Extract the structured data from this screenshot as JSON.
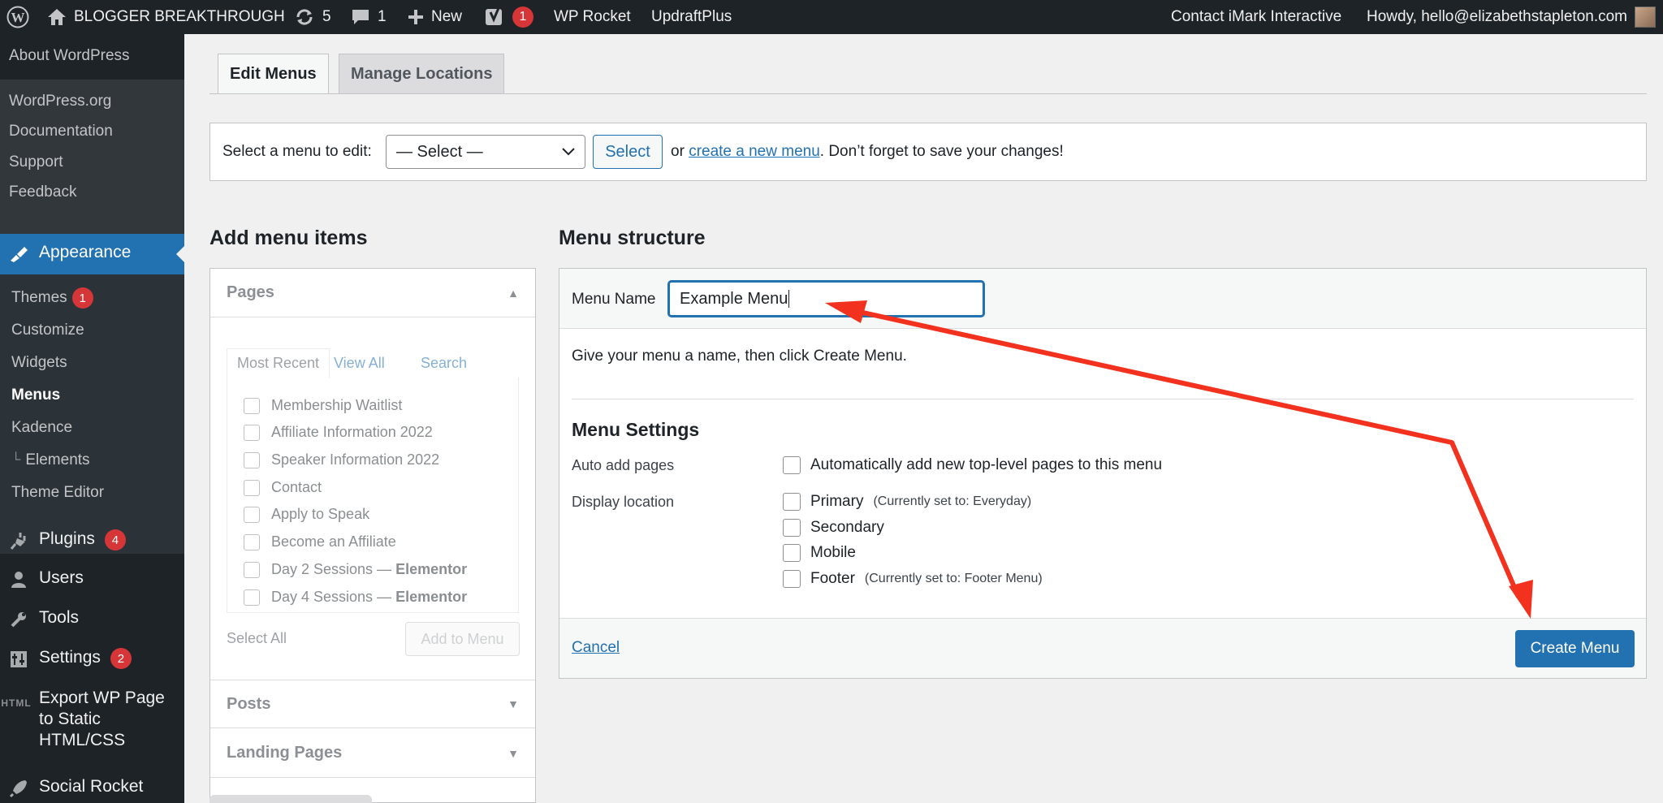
{
  "admin_bar": {
    "site_name": "BLOGGER BREAKTHROUGH",
    "updates_count": "5",
    "comments_count": "1",
    "new_label": "New",
    "yoast_badge": "1",
    "wp_rocket": "WP Rocket",
    "updraftplus": "UpdraftPlus",
    "contact": "Contact iMark Interactive",
    "howdy": "Howdy, hello@elizabethstapleton.com"
  },
  "sidebar": {
    "wp_links": [
      "About WordPress",
      "WordPress.org",
      "Documentation",
      "Support",
      "Feedback"
    ],
    "appearance": "Appearance",
    "appearance_sub": {
      "themes": "Themes",
      "themes_badge": "1",
      "customize": "Customize",
      "widgets": "Widgets",
      "menus": "Menus",
      "kadence": "Kadence",
      "elements": "Elements",
      "theme_editor": "Theme Editor"
    },
    "plugins": "Plugins",
    "plugins_badge": "4",
    "users": "Users",
    "tools": "Tools",
    "settings": "Settings",
    "settings_badge": "2",
    "export_line1": "Export WP Page",
    "export_line2": "to Static",
    "export_line3": "HTML/CSS",
    "export_icon_text": "HTML",
    "social_rocket": "Social Rocket"
  },
  "tabs": {
    "edit_menus": "Edit Menus",
    "manage_locations": "Manage Locations"
  },
  "select_bar": {
    "label": "Select a menu to edit:",
    "dropdown_value": "— Select —",
    "select_button": "Select",
    "or_text": "or",
    "create_link": "create a new menu",
    "after_text": ". Don’t forget to save your changes!"
  },
  "add_items": {
    "heading": "Add menu items",
    "pages_title": "Pages",
    "tabs": [
      "Most Recent",
      "View All",
      "Search"
    ],
    "pages": [
      {
        "title": "Membership Waitlist",
        "suffix": ""
      },
      {
        "title": "Affiliate Information 2022",
        "suffix": ""
      },
      {
        "title": "Speaker Information 2022",
        "suffix": ""
      },
      {
        "title": "Contact",
        "suffix": ""
      },
      {
        "title": "Apply to Speak",
        "suffix": ""
      },
      {
        "title": "Become an Affiliate",
        "suffix": ""
      },
      {
        "title": "Day 2 Sessions — ",
        "suffix": "Elementor"
      },
      {
        "title": "Day 4 Sessions — ",
        "suffix": "Elementor"
      }
    ],
    "select_all": "Select All",
    "add_to_menu": "Add to Menu",
    "posts_title": "Posts",
    "landing_pages_title": "Landing Pages"
  },
  "menu_structure": {
    "heading": "Menu structure",
    "menu_name_label": "Menu Name",
    "menu_name_value": "Example Menu",
    "instructions": "Give your menu a name, then click Create Menu.",
    "settings_heading": "Menu Settings",
    "auto_add_label": "Auto add pages",
    "auto_add_option": "Automatically add new top-level pages to this menu",
    "display_location_label": "Display location",
    "locations": [
      {
        "name": "Primary",
        "note": "(Currently set to: Everyday)"
      },
      {
        "name": "Secondary",
        "note": ""
      },
      {
        "name": "Mobile",
        "note": ""
      },
      {
        "name": "Footer",
        "note": "(Currently set to: Footer Menu)"
      }
    ],
    "cancel": "Cancel",
    "create_button": "Create Menu"
  },
  "colors": {
    "admin_dark": "#1d2327",
    "accent_blue": "#2271b1",
    "badge_red": "#d63638",
    "annotation_arrow": "#f2321e"
  }
}
